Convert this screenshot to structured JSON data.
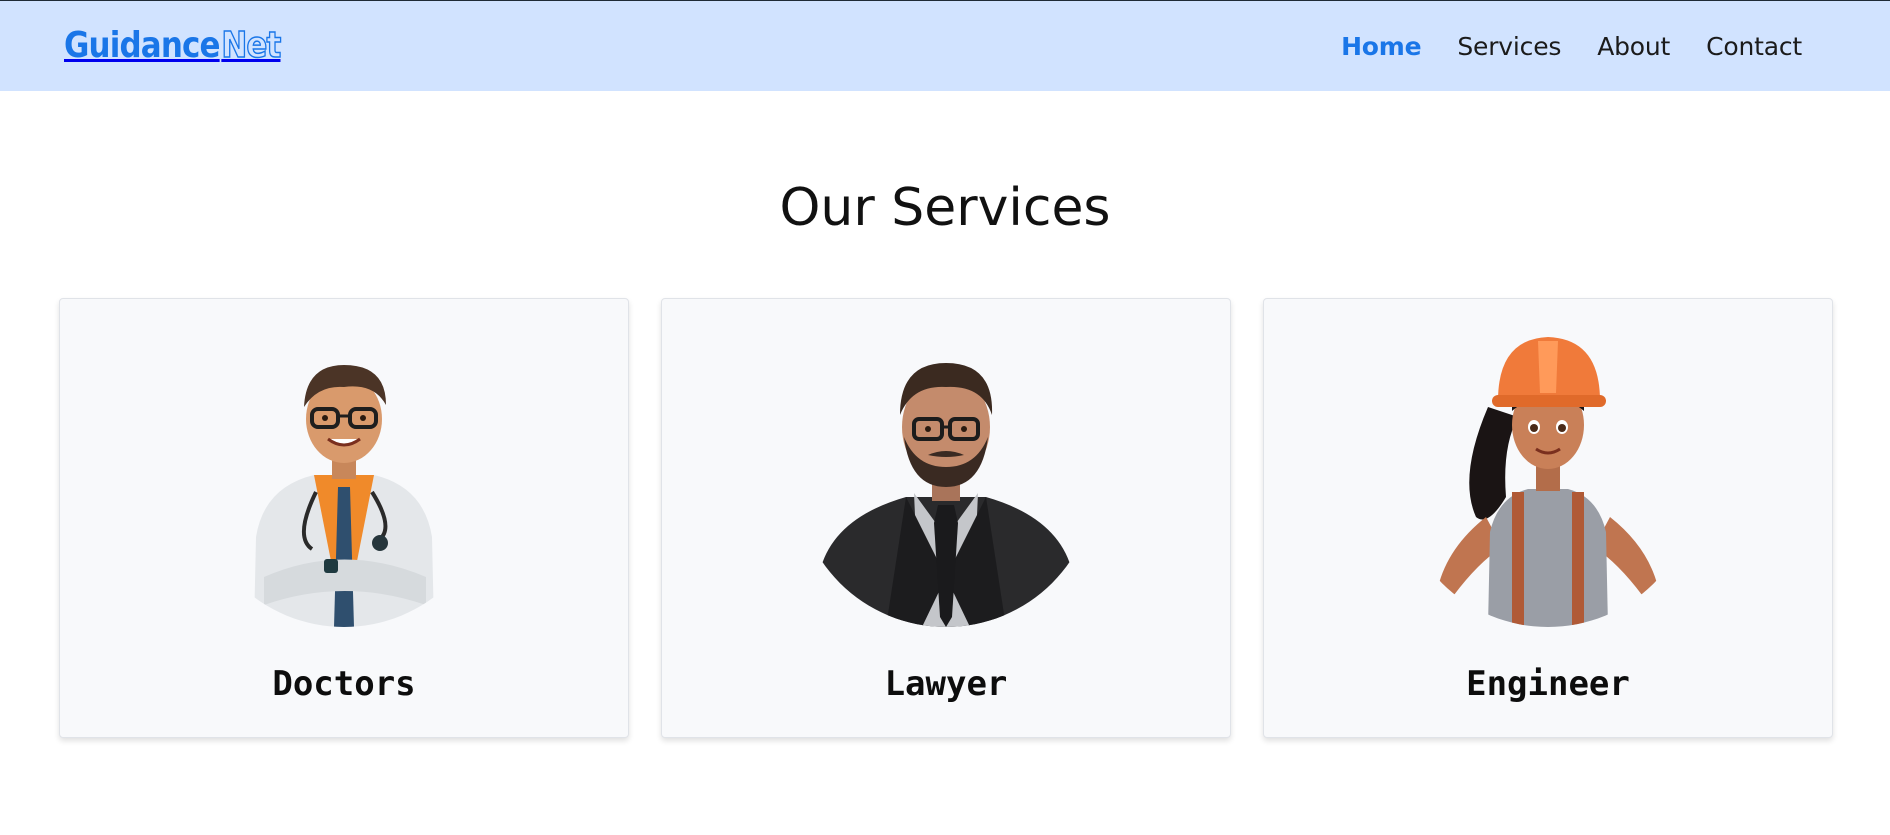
{
  "header": {
    "logo_part1": "Guidance",
    "logo_part2": "Net",
    "nav": [
      {
        "label": "Home",
        "active": true
      },
      {
        "label": "Services",
        "active": false
      },
      {
        "label": "About",
        "active": false
      },
      {
        "label": "Contact",
        "active": false
      }
    ]
  },
  "main": {
    "title": "Our Services",
    "cards": [
      {
        "label": "Doctors",
        "image": "doctor-avatar-icon"
      },
      {
        "label": "Lawyer",
        "image": "lawyer-avatar-icon"
      },
      {
        "label": "Engineer",
        "image": "engineer-avatar-icon"
      }
    ]
  },
  "colors": {
    "header_bg": "#d1e3ff",
    "accent": "#1a76e8",
    "card_bg": "#f8f9fb"
  }
}
